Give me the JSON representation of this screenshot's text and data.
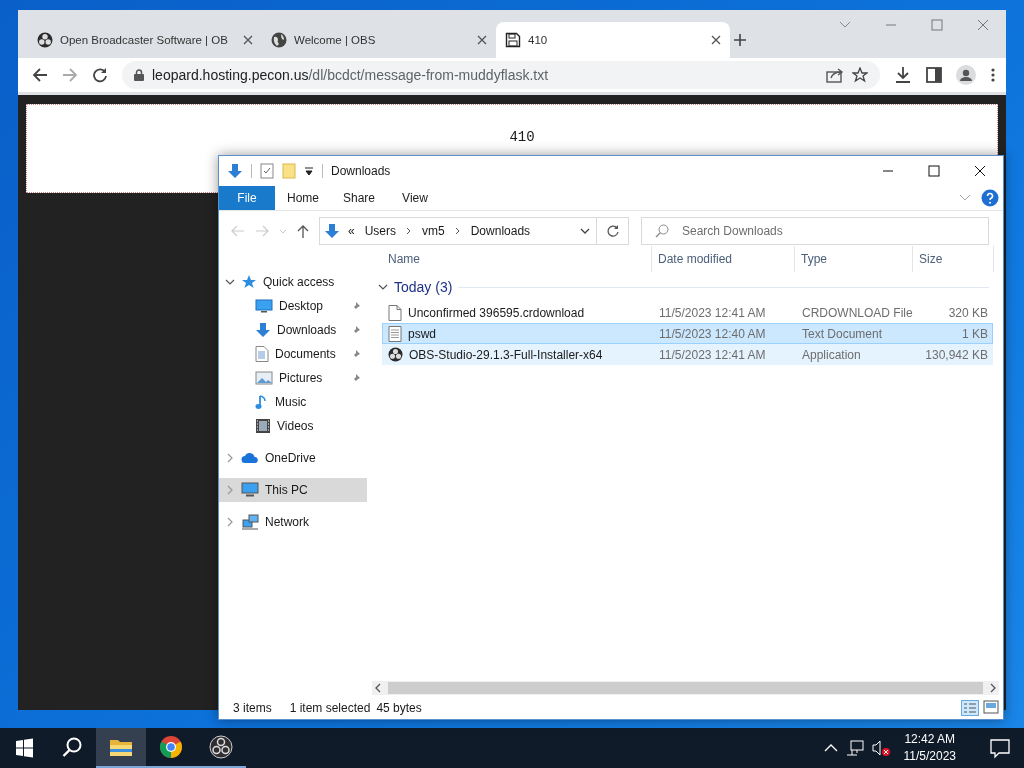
{
  "browser": {
    "tabs": [
      {
        "title": "Open Broadcaster Software | OB",
        "kind": "obs",
        "selected": false
      },
      {
        "title": "Welcome | OBS",
        "kind": "globe",
        "selected": false
      },
      {
        "title": "410",
        "kind": "floppy",
        "selected": true
      }
    ],
    "url_host": "leopard.hosting.pecon.us",
    "url_path": "/dl/bcdct/message-from-muddyflask.txt",
    "page_text": "410"
  },
  "explorer": {
    "title": "Downloads",
    "ribbon_tabs": [
      {
        "label": "File",
        "selected": true
      },
      {
        "label": "Home",
        "selected": false
      },
      {
        "label": "Share",
        "selected": false
      },
      {
        "label": "View",
        "selected": false
      }
    ],
    "breadcrumb_overflow": "«",
    "breadcrumb": [
      "Users",
      "vm5",
      "Downloads"
    ],
    "search": {
      "placeholder": "Search Downloads"
    },
    "nav": [
      {
        "label": "Quick access",
        "kind": "star",
        "expanded": true,
        "selected": false,
        "children": [
          {
            "label": "Desktop",
            "kind": "desktop",
            "pinned": true
          },
          {
            "label": "Downloads",
            "kind": "download",
            "pinned": true
          },
          {
            "label": "Documents",
            "kind": "document",
            "pinned": true
          },
          {
            "label": "Pictures",
            "kind": "pictures",
            "pinned": true
          },
          {
            "label": "Music",
            "kind": "music",
            "pinned": false
          },
          {
            "label": "Videos",
            "kind": "videos",
            "pinned": false
          }
        ]
      },
      {
        "label": "OneDrive",
        "kind": "cloud",
        "expanded": false,
        "selected": false
      },
      {
        "label": "This PC",
        "kind": "pc",
        "expanded": false,
        "selected": true
      },
      {
        "label": "Network",
        "kind": "network",
        "expanded": false,
        "selected": false
      }
    ],
    "columns": [
      "Name",
      "Date modified",
      "Type",
      "Size"
    ],
    "group": {
      "label": "Today (3)",
      "expanded": true
    },
    "files": [
      {
        "name": "Unconfirmed 396595.crdownload",
        "date": "11/5/2023 12:41 AM",
        "type": "CRDOWNLOAD File",
        "size": "320 KB",
        "kind": "file",
        "selected": false,
        "hovered": false
      },
      {
        "name": "pswd",
        "date": "11/5/2023 12:40 AM",
        "type": "Text Document",
        "size": "1 KB",
        "kind": "text",
        "selected": true,
        "hovered": false
      },
      {
        "name": "OBS-Studio-29.1.3-Full-Installer-x64",
        "date": "11/5/2023 12:41 AM",
        "type": "Application",
        "size": "130,942 KB",
        "kind": "app",
        "selected": false,
        "hovered": true
      }
    ],
    "status": {
      "count": "3 items",
      "selection": "1 item selected",
      "size": "45 bytes"
    }
  },
  "taskbar": {
    "apps": [
      {
        "kind": "folder",
        "active": true,
        "running": true
      },
      {
        "kind": "chrome",
        "active": false,
        "running": true
      },
      {
        "kind": "obs",
        "active": false,
        "running": true
      }
    ],
    "time": "12:42 AM",
    "date": "11/5/2023"
  }
}
